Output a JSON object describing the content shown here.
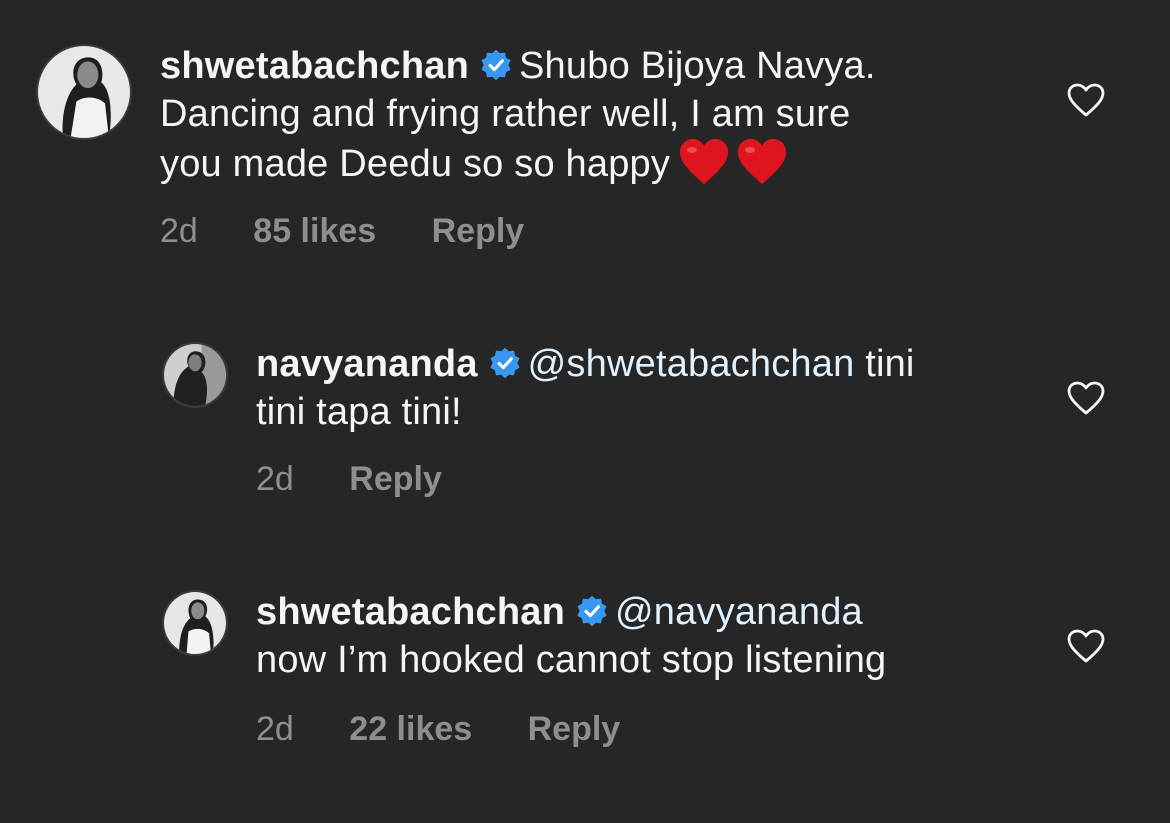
{
  "colors": {
    "background": "#262626",
    "text": "#f5f5f5",
    "meta": "#8e8e8e",
    "mention": "#e0f1ff",
    "verified": "#3897f0",
    "heart_emoji": "#e0141e"
  },
  "icons": {
    "verified": "verified-badge-icon",
    "like": "heart-outline-icon",
    "emoji": "red-heart-emoji"
  },
  "comments": [
    {
      "username": "shwetabachchan",
      "verified": true,
      "text_line1": "Shubo Bijoya Navya.",
      "text_line2": "Dancing and frying rather well, I am sure",
      "text_line3": "you made  Deedu so so happy",
      "emoji_count": 2,
      "time": "2d",
      "likes": "85 likes",
      "reply": "Reply"
    },
    {
      "username": "navyananda",
      "verified": true,
      "mention": "@shwetabachchan",
      "text_line1": " tini",
      "text_line2": "tini tapa tini!",
      "time": "2d",
      "reply": "Reply"
    },
    {
      "username": "shwetabachchan",
      "verified": true,
      "mention": "@navyananda",
      "text_line2": "now I’m hooked cannot stop listening",
      "time": "2d",
      "likes": "22 likes",
      "reply": "Reply"
    }
  ]
}
